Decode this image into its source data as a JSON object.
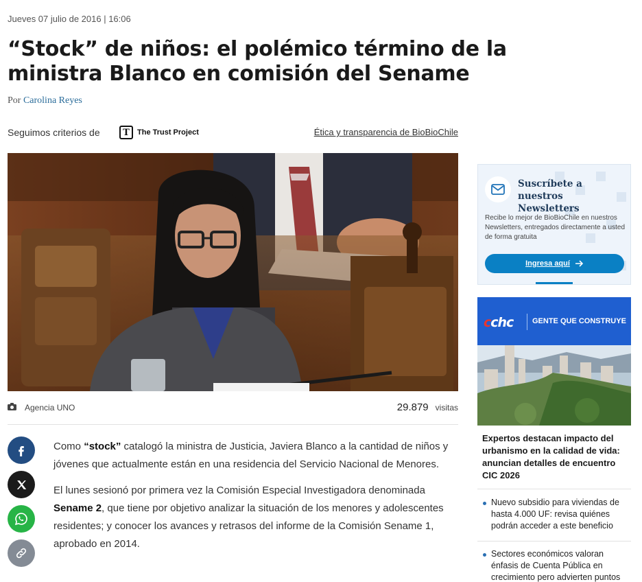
{
  "article": {
    "date": "Jueves 07 julio de 2016 | 16:06",
    "headline": "“Stock” de niños: el polémico término de la ministra Blanco en comisión del Sename",
    "byline_prefix": "Por",
    "author": "Carolina Reyes"
  },
  "trust": {
    "label": "Seguimos criterios de",
    "badge_letter": "T",
    "badge_name": "The Trust Project",
    "ethics_link": "Ética y transparencia de BioBioChile"
  },
  "photo": {
    "credit": "Agencia UNO",
    "visits_count": "29.879",
    "visits_label": "visitas"
  },
  "share": {
    "icons": [
      "facebook-icon",
      "x-icon",
      "whatsapp-icon",
      "link-icon"
    ]
  },
  "body": {
    "p1_a": "Como ",
    "p1_b": "“stock”",
    "p1_c": " catalogó la ministra de Justicia, Javiera Blanco a la cantidad de niños y jóvenes que actualmente están en una residencia del Servicio Nacional de Menores.",
    "p2_a": "El lunes sesionó por primera vez la Comisión Especial Investigadora denominada ",
    "p2_b": "Sename 2",
    "p2_c": ", que tiene por objetivo analizar la situación de los menores y adolescentes residentes; y conocer los avances y retrasos del informe de la Comisión Sename 1, aprobado en 2014."
  },
  "newsletter": {
    "title": "Suscríbete a nuestros Newsletters",
    "description": "Recibe lo mejor de BioBioChile en nuestros Newsletters, entregados directamente a usted de forma gratuita",
    "cta": "Ingresa aquí"
  },
  "ad": {
    "logo": "cchc",
    "slogan": "GENTE QUE CONSTRUYE",
    "title": "Expertos destacan impacto del urbanismo en la calidad de vida: anuncian detalles de encuentro CIC 2026"
  },
  "sidebar_news": [
    "Nuevo subsidio para viviendas de hasta 4.000 UF: revisa quiénes podrán acceder a este beneficio",
    "Sectores económicos valoran énfasis de Cuenta Pública en crecimiento pero advierten puntos"
  ],
  "colors": {
    "link": "#2a6c9a",
    "facebook": "#234d82",
    "whatsapp": "#27b446",
    "newsletter_cta": "#0a80c4",
    "ad_blue": "#1f5fd0"
  }
}
